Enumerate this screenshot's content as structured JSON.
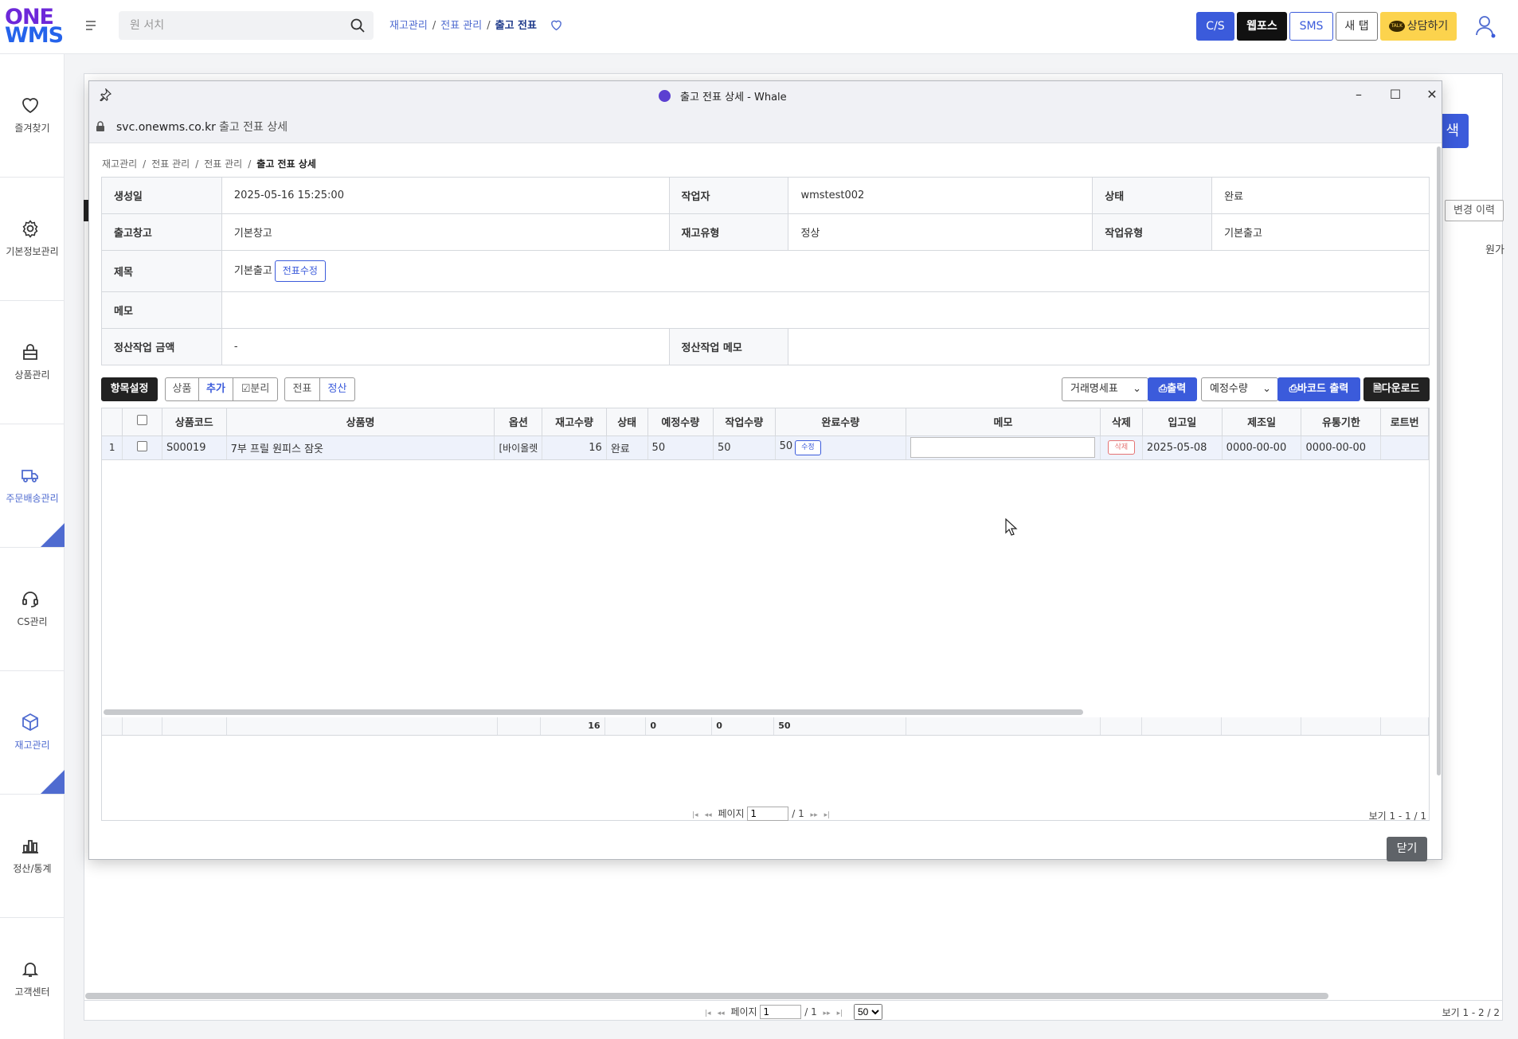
{
  "app": {
    "logo_line1": "ONE",
    "logo_line2": "WMS",
    "brand_color": "#3b5bdb"
  },
  "topbar": {
    "search_placeholder": "원 서치",
    "breadcrumb": [
      "재고관리",
      "전표 관리",
      "출고 전표"
    ],
    "buttons": {
      "cs": "C/S",
      "webpos": "웹포스",
      "sms": "SMS",
      "new_tab": "새 탭",
      "talk": "상담하기",
      "talk_badge": "TALK"
    }
  },
  "sidebar": {
    "items": [
      {
        "label": "즐겨찾기",
        "icon": "heart-icon"
      },
      {
        "label": "기본정보관리",
        "icon": "gear-icon"
      },
      {
        "label": "상품관리",
        "icon": "bag-icon"
      },
      {
        "label": "주문배송관리",
        "icon": "truck-icon"
      },
      {
        "label": "CS관리",
        "icon": "headset-icon"
      },
      {
        "label": "재고관리",
        "icon": "box-icon"
      },
      {
        "label": "정산/통계",
        "icon": "bar-chart-icon"
      },
      {
        "label": "고객센터",
        "icon": "bell-icon"
      }
    ]
  },
  "background": {
    "search_button": "색",
    "history_button": "변경 이력",
    "col_header": "원가",
    "pager": {
      "page_label": "페이지",
      "page_value": "1",
      "total": "/ 1",
      "page_size": "50",
      "view": "보기 1 - 2 / 2"
    }
  },
  "popup": {
    "window_title": "출고 전표 상세 - Whale",
    "url": "svc.onewms.co.kr",
    "page_title": "출고 전표 상세",
    "breadcrumb": [
      "재고관리",
      "전표 관리",
      "전표 관리",
      "출고 전표 상세"
    ],
    "info": {
      "created_label": "생성일",
      "created_value": "2025-05-16 15:25:00",
      "worker_label": "작업자",
      "worker_value": "wmstest002",
      "status_label": "상태",
      "status_value": "완료",
      "warehouse_label": "출고창고",
      "warehouse_value": "기본창고",
      "stock_type_label": "재고유형",
      "stock_type_value": "정상",
      "work_type_label": "작업유형",
      "work_type_value": "기본출고",
      "subject_label": "제목",
      "subject_value": "기본출고",
      "edit_button": "전표수정",
      "memo_label": "메모",
      "memo_value": "",
      "settle_amount_label": "정산작업 금액",
      "settle_amount_value": "-",
      "settle_memo_label": "정산작업 메모",
      "settle_memo_value": ""
    },
    "toolbar": {
      "column_settings": "항목설정",
      "product": "상품",
      "add": "추가",
      "split": "분리",
      "slip": "전표",
      "settle": "정산",
      "invoice_select": "거래명세표",
      "print": "출력",
      "qty_select": "예정수량",
      "barcode_print": "바코드 출력",
      "download": "다운로드"
    },
    "grid": {
      "columns": [
        "",
        "",
        "상품코드",
        "상품명",
        "옵션",
        "재고수량",
        "상태",
        "예정수량",
        "작업수량",
        "완료수량",
        "메모",
        "삭제",
        "입고일",
        "제조일",
        "유통기한",
        "로트번"
      ],
      "rows": [
        {
          "no": "1",
          "code": "S00019",
          "name": "7부 프릴 원피스 잠옷",
          "option": "[바이올렛",
          "stock": "16",
          "status": "완료",
          "planned": "50",
          "worked": "50",
          "done": "50",
          "modify_button": "수정",
          "memo": "",
          "delete_button": "삭제",
          "in_date": "2025-05-08",
          "mfg_date": "0000-00-00",
          "exp_date": "0000-00-00",
          "lot": ""
        }
      ],
      "totals": {
        "stock": "16",
        "planned": "0",
        "worked": "0",
        "done": "50"
      },
      "pager": {
        "page_label": "페이지",
        "page_value": "1",
        "total": "/ 1",
        "view": "보기 1 - 1 / 1"
      }
    },
    "close_button": "닫기"
  }
}
